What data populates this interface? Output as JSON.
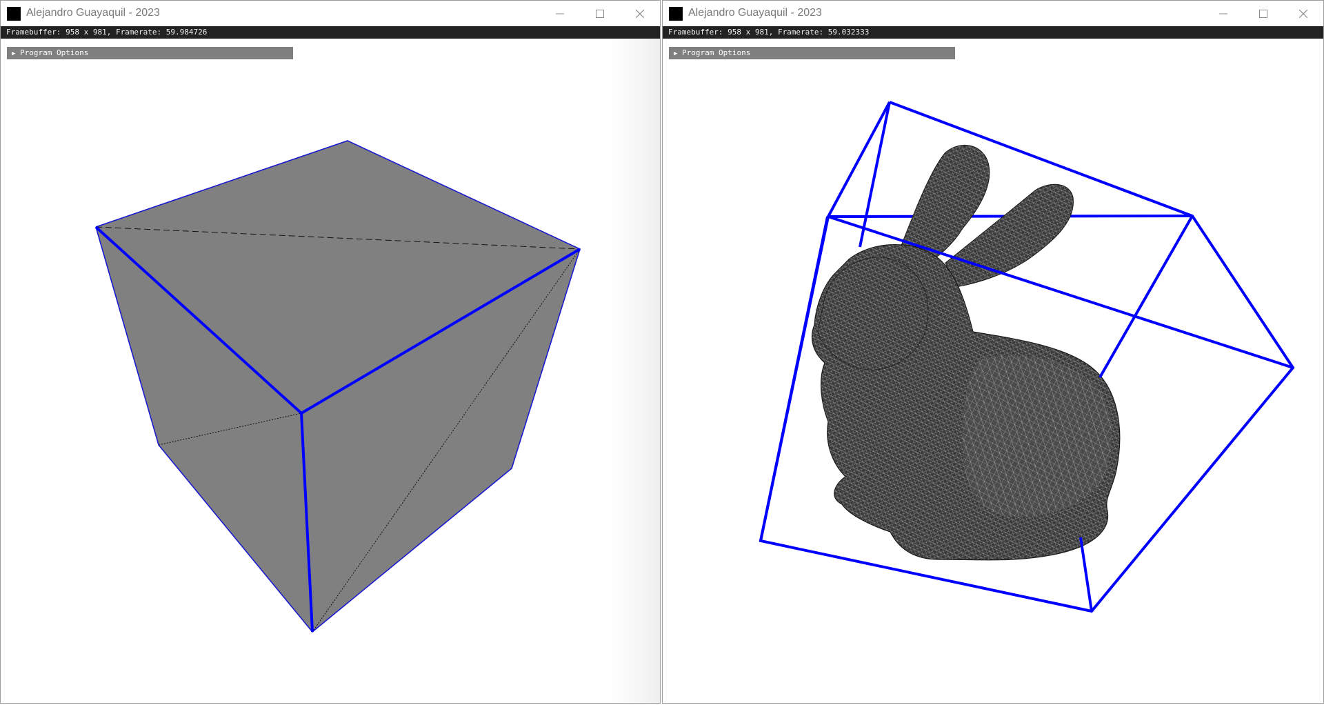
{
  "windows": [
    {
      "title": "Alejandro Guayaquil - 2023",
      "status": "Framebuffer: 958 x 981, Framerate: 59.984726",
      "options_label": "Program Options",
      "scene": "cube",
      "icons": {
        "app": "app-icon",
        "minimize": "minimize-icon",
        "maximize": "maximize-icon",
        "close": "close-icon",
        "arrow": "triangle-right-icon"
      }
    },
    {
      "title": "Alejandro Guayaquil - 2023",
      "status": "Framebuffer: 958 x 981, Framerate: 59.032333",
      "options_label": "Program Options",
      "scene": "bunny",
      "icons": {
        "app": "app-icon",
        "minimize": "minimize-icon",
        "maximize": "maximize-icon",
        "close": "close-icon",
        "arrow": "triangle-right-icon"
      }
    }
  ],
  "colors": {
    "edge_blue": "#0000ff",
    "face_gray": "#808080",
    "mesh_dark": "#2e2e2e",
    "status_bg": "#222222",
    "panel_bg": "#7f7f7f"
  }
}
